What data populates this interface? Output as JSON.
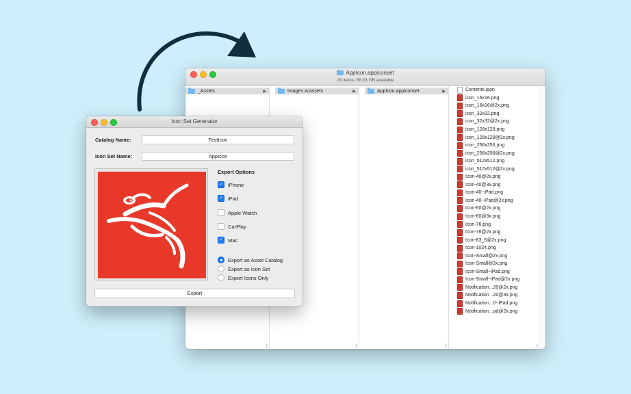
{
  "finder": {
    "title": "AppIcon.appiconset",
    "status": "29 items, 88.03 GB available",
    "columns": [
      "_Assets",
      "Images.xcassets",
      "AppIcon.appiconset"
    ],
    "files": [
      {
        "name": "Contents.json",
        "type": "json"
      },
      {
        "name": "icon_16x16.png",
        "type": "png"
      },
      {
        "name": "icon_16x16@2x.png",
        "type": "png"
      },
      {
        "name": "icon_32x32.png",
        "type": "png"
      },
      {
        "name": "icon_32x32@2x.png",
        "type": "png"
      },
      {
        "name": "icon_128x128.png",
        "type": "png"
      },
      {
        "name": "icon_128x128@2x.png",
        "type": "png"
      },
      {
        "name": "icon_256x256.png",
        "type": "png"
      },
      {
        "name": "icon_256x256@2x.png",
        "type": "png"
      },
      {
        "name": "icon_512x512.png",
        "type": "png"
      },
      {
        "name": "icon_512x512@2x.png",
        "type": "png"
      },
      {
        "name": "Icon-40@2x.png",
        "type": "png"
      },
      {
        "name": "Icon-40@3x.png",
        "type": "png"
      },
      {
        "name": "Icon-40~iPad.png",
        "type": "png"
      },
      {
        "name": "Icon-40~iPad@2x.png",
        "type": "png"
      },
      {
        "name": "Icon-60@2x.png",
        "type": "png"
      },
      {
        "name": "Icon-60@3x.png",
        "type": "png"
      },
      {
        "name": "Icon-76.png",
        "type": "png"
      },
      {
        "name": "Icon-76@2x.png",
        "type": "png"
      },
      {
        "name": "Icon-83_5@2x.png",
        "type": "png"
      },
      {
        "name": "Icon-1024.png",
        "type": "png"
      },
      {
        "name": "Icon-Small@2x.png",
        "type": "png"
      },
      {
        "name": "Icon-Small@3x.png",
        "type": "png"
      },
      {
        "name": "Icon-Small~iPad.png",
        "type": "png"
      },
      {
        "name": "Icon-Small~iPad@2x.png",
        "type": "png"
      },
      {
        "name": "Notification...20@2x.png",
        "type": "png"
      },
      {
        "name": "Notification...20@3x.png",
        "type": "png"
      },
      {
        "name": "Notification...0~iPad.png",
        "type": "png"
      },
      {
        "name": "Notification...ad@2x.png",
        "type": "png"
      }
    ]
  },
  "generator": {
    "title": "Icon Set Generator",
    "catalog_label": "Catalog Name:",
    "catalog_value": "TestIcon",
    "iconset_label": "Icon Set Name:",
    "iconset_value": "AppIcon",
    "options_title": "Export Options",
    "checkboxes": [
      {
        "label": "iPhone",
        "checked": true
      },
      {
        "label": "iPad",
        "checked": true
      },
      {
        "label": "Apple Watch",
        "checked": false
      },
      {
        "label": "CarPlay",
        "checked": false
      },
      {
        "label": "Mac",
        "checked": true
      }
    ],
    "radios": [
      {
        "label": "Export as Asset Catalog",
        "selected": true
      },
      {
        "label": "Export as Icon Set",
        "selected": false
      },
      {
        "label": "Export Icons Only",
        "selected": false
      }
    ],
    "export_label": "Export",
    "icon_color": "#e8382a"
  }
}
